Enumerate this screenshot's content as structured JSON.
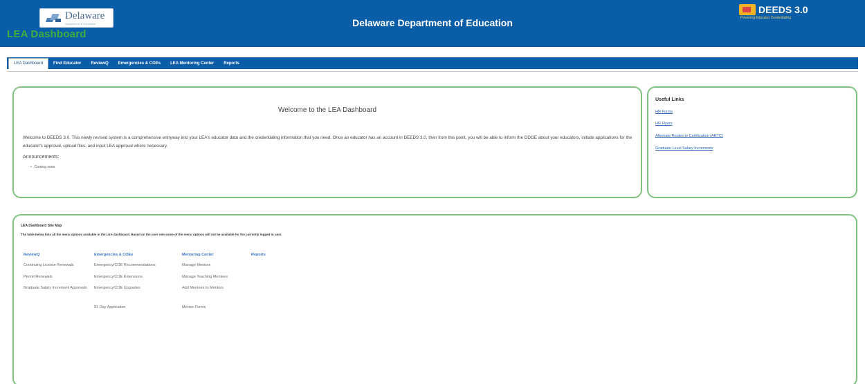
{
  "header": {
    "logo_name": "Delaware",
    "logo_sub": "Department of Education",
    "dashboard_title": "LEA Dashboard",
    "department_title": "Delaware Department of Education",
    "deeds_title": "DEEDS 3.0",
    "deeds_tagline": "Powering Educator Credentialing",
    "bar_color": "#0a5ea8",
    "accent_green": "#3fae3f"
  },
  "nav": {
    "items": [
      {
        "label": "LEA Dashboard",
        "active": true
      },
      {
        "label": "Find Educator"
      },
      {
        "label": "ReviewQ"
      },
      {
        "label": "Emergencies & COEs"
      },
      {
        "label": "LEA Mentoring Center"
      },
      {
        "label": "Reports"
      }
    ]
  },
  "welcome": {
    "heading": "Welcome to the LEA Dashboard",
    "body": "Welcome to DEEDS 3.0. This newly revised system is a comprehensive entryway into your LEA's educator data and the credentialing information that you need. Once an educator has an account in DEEDS 3.0, then from this point, you will be able to inform the DDOE about your educators, initiate applications for the educator's approval, upload files, and input LEA approval where necessary.",
    "announcements_label": "Announcements:",
    "announcements": [
      "Coming soon"
    ]
  },
  "useful_links": {
    "title": "Useful Links",
    "links": [
      "HR Forms",
      "HR Flyers",
      "Alternate Routes to Certification (ARTC)",
      "Graduate Level Salary Increments"
    ]
  },
  "sitemap": {
    "title": "LEA Dashboard Site Map",
    "description": "The table below lists all the menu options available in the LEA dashboard. Based on the user role some of the menu options will not be available for the currently logged in user.",
    "columns": [
      {
        "heading": "ReviewQ",
        "items": [
          "Continuing License Renewals",
          "Permit Renewals",
          "Graduate Salary Increment Approvals"
        ]
      },
      {
        "heading": "Emergencies & COEs",
        "items": [
          "Emergency/COE Recommendations",
          "Emergency/COE Extensions",
          "Emergency/COE Upgrades",
          "91 Day Application"
        ]
      },
      {
        "heading": "Mentoring Center",
        "items": [
          "Manage Mentors",
          "Manage Teaching Mentees",
          "Add Mentees to Mentors",
          "Mentor Forms"
        ]
      },
      {
        "heading": "Reports",
        "items": []
      }
    ]
  }
}
